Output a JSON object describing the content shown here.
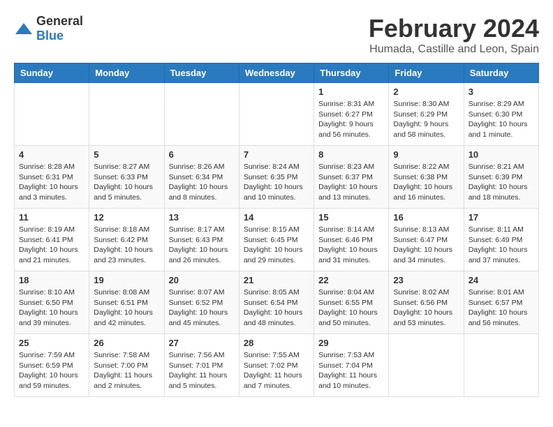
{
  "logo": {
    "general": "General",
    "blue": "Blue"
  },
  "title": "February 2024",
  "location": "Humada, Castille and Leon, Spain",
  "days_of_week": [
    "Sunday",
    "Monday",
    "Tuesday",
    "Wednesday",
    "Thursday",
    "Friday",
    "Saturday"
  ],
  "weeks": [
    [
      {
        "day": "",
        "info": ""
      },
      {
        "day": "",
        "info": ""
      },
      {
        "day": "",
        "info": ""
      },
      {
        "day": "",
        "info": ""
      },
      {
        "day": "1",
        "info": "Sunrise: 8:31 AM\nSunset: 6:27 PM\nDaylight: 9 hours and 56 minutes."
      },
      {
        "day": "2",
        "info": "Sunrise: 8:30 AM\nSunset: 6:29 PM\nDaylight: 9 hours and 58 minutes."
      },
      {
        "day": "3",
        "info": "Sunrise: 8:29 AM\nSunset: 6:30 PM\nDaylight: 10 hours and 1 minute."
      }
    ],
    [
      {
        "day": "4",
        "info": "Sunrise: 8:28 AM\nSunset: 6:31 PM\nDaylight: 10 hours and 3 minutes."
      },
      {
        "day": "5",
        "info": "Sunrise: 8:27 AM\nSunset: 6:33 PM\nDaylight: 10 hours and 5 minutes."
      },
      {
        "day": "6",
        "info": "Sunrise: 8:26 AM\nSunset: 6:34 PM\nDaylight: 10 hours and 8 minutes."
      },
      {
        "day": "7",
        "info": "Sunrise: 8:24 AM\nSunset: 6:35 PM\nDaylight: 10 hours and 10 minutes."
      },
      {
        "day": "8",
        "info": "Sunrise: 8:23 AM\nSunset: 6:37 PM\nDaylight: 10 hours and 13 minutes."
      },
      {
        "day": "9",
        "info": "Sunrise: 8:22 AM\nSunset: 6:38 PM\nDaylight: 10 hours and 16 minutes."
      },
      {
        "day": "10",
        "info": "Sunrise: 8:21 AM\nSunset: 6:39 PM\nDaylight: 10 hours and 18 minutes."
      }
    ],
    [
      {
        "day": "11",
        "info": "Sunrise: 8:19 AM\nSunset: 6:41 PM\nDaylight: 10 hours and 21 minutes."
      },
      {
        "day": "12",
        "info": "Sunrise: 8:18 AM\nSunset: 6:42 PM\nDaylight: 10 hours and 23 minutes."
      },
      {
        "day": "13",
        "info": "Sunrise: 8:17 AM\nSunset: 6:43 PM\nDaylight: 10 hours and 26 minutes."
      },
      {
        "day": "14",
        "info": "Sunrise: 8:15 AM\nSunset: 6:45 PM\nDaylight: 10 hours and 29 minutes."
      },
      {
        "day": "15",
        "info": "Sunrise: 8:14 AM\nSunset: 6:46 PM\nDaylight: 10 hours and 31 minutes."
      },
      {
        "day": "16",
        "info": "Sunrise: 8:13 AM\nSunset: 6:47 PM\nDaylight: 10 hours and 34 minutes."
      },
      {
        "day": "17",
        "info": "Sunrise: 8:11 AM\nSunset: 6:49 PM\nDaylight: 10 hours and 37 minutes."
      }
    ],
    [
      {
        "day": "18",
        "info": "Sunrise: 8:10 AM\nSunset: 6:50 PM\nDaylight: 10 hours and 39 minutes."
      },
      {
        "day": "19",
        "info": "Sunrise: 8:08 AM\nSunset: 6:51 PM\nDaylight: 10 hours and 42 minutes."
      },
      {
        "day": "20",
        "info": "Sunrise: 8:07 AM\nSunset: 6:52 PM\nDaylight: 10 hours and 45 minutes."
      },
      {
        "day": "21",
        "info": "Sunrise: 8:05 AM\nSunset: 6:54 PM\nDaylight: 10 hours and 48 minutes."
      },
      {
        "day": "22",
        "info": "Sunrise: 8:04 AM\nSunset: 6:55 PM\nDaylight: 10 hours and 50 minutes."
      },
      {
        "day": "23",
        "info": "Sunrise: 8:02 AM\nSunset: 6:56 PM\nDaylight: 10 hours and 53 minutes."
      },
      {
        "day": "24",
        "info": "Sunrise: 8:01 AM\nSunset: 6:57 PM\nDaylight: 10 hours and 56 minutes."
      }
    ],
    [
      {
        "day": "25",
        "info": "Sunrise: 7:59 AM\nSunset: 6:59 PM\nDaylight: 10 hours and 59 minutes."
      },
      {
        "day": "26",
        "info": "Sunrise: 7:58 AM\nSunset: 7:00 PM\nDaylight: 11 hours and 2 minutes."
      },
      {
        "day": "27",
        "info": "Sunrise: 7:56 AM\nSunset: 7:01 PM\nDaylight: 11 hours and 5 minutes."
      },
      {
        "day": "28",
        "info": "Sunrise: 7:55 AM\nSunset: 7:02 PM\nDaylight: 11 hours and 7 minutes."
      },
      {
        "day": "29",
        "info": "Sunrise: 7:53 AM\nSunset: 7:04 PM\nDaylight: 11 hours and 10 minutes."
      },
      {
        "day": "",
        "info": ""
      },
      {
        "day": "",
        "info": ""
      }
    ]
  ]
}
